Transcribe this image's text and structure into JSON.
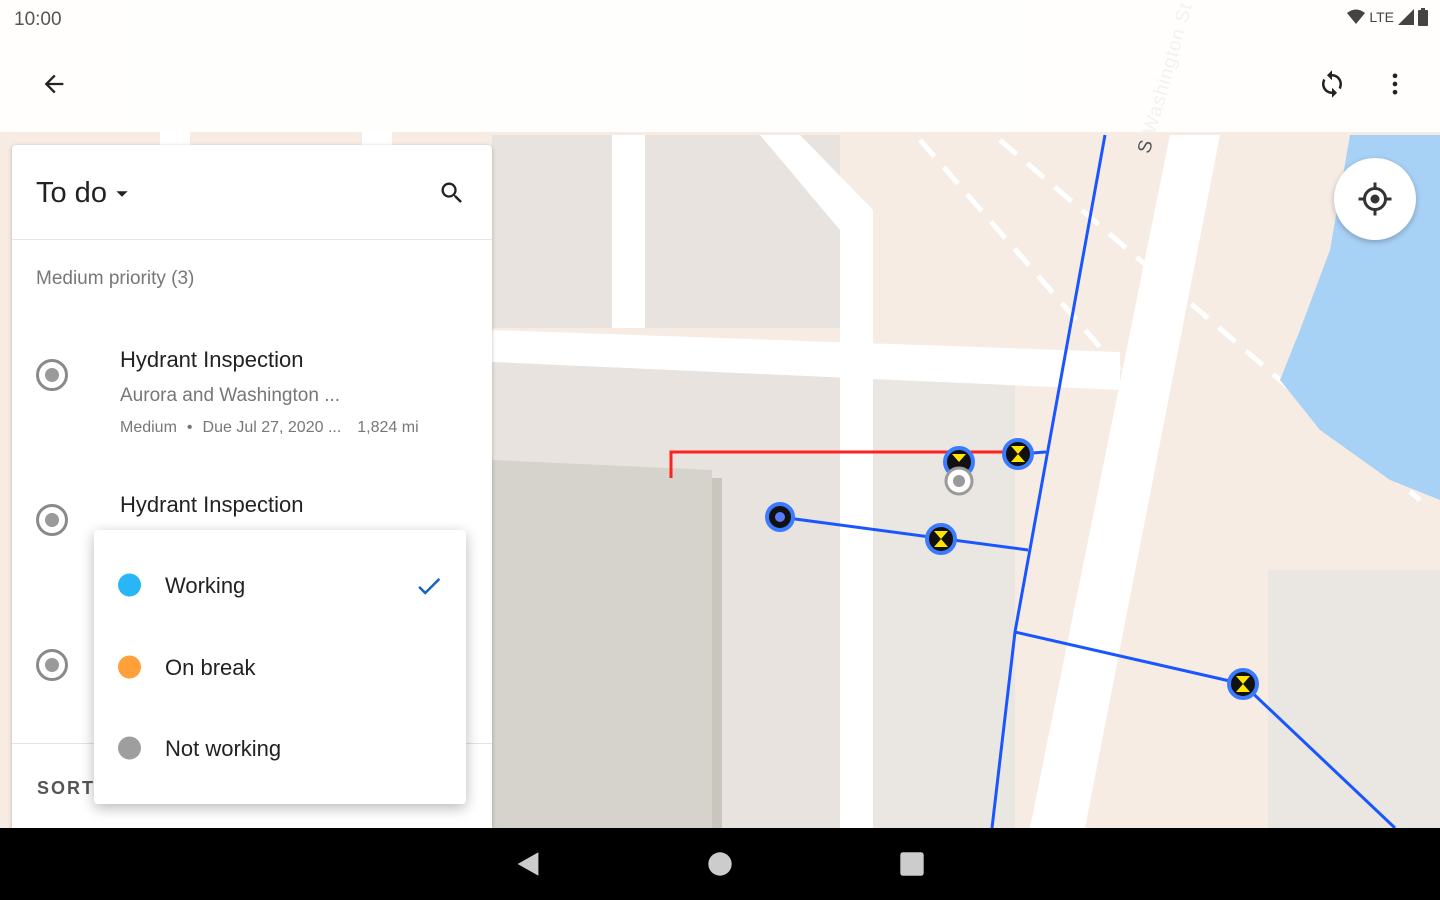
{
  "status_bar": {
    "time": "10:00",
    "network": "LTE"
  },
  "toolbar": {
    "back_icon": "arrow-back-icon",
    "sync_icon": "sync-icon",
    "more_icon": "more-vert-icon"
  },
  "panel": {
    "title": "To do",
    "section_label": "Medium priority (3)",
    "items": [
      {
        "title": "Hydrant Inspection",
        "location": "Aurora and Washington ...",
        "priority": "Medium",
        "due": "Due Jul 27, 2020 ...",
        "distance": "1,824 mi"
      },
      {
        "title": "Hydrant Inspection"
      },
      {
        "title": ""
      }
    ],
    "sort_label": "SORT"
  },
  "status_menu": {
    "items": [
      {
        "label": "Working",
        "color": "#29b6f6",
        "selected": true
      },
      {
        "label": "On break",
        "color": "#ffa03a",
        "selected": false
      },
      {
        "label": "Not working",
        "color": "#9e9e9e",
        "selected": false
      }
    ]
  },
  "map": {
    "street_label": "S Washington St",
    "water_color": "#a8d1f6",
    "main_line_color": "#1a56ff",
    "service_line_color": "#ff2020"
  },
  "nav_bar": {
    "back_icon": "triangle-back-icon",
    "home_icon": "circle-home-icon",
    "recents_icon": "square-recents-icon"
  }
}
